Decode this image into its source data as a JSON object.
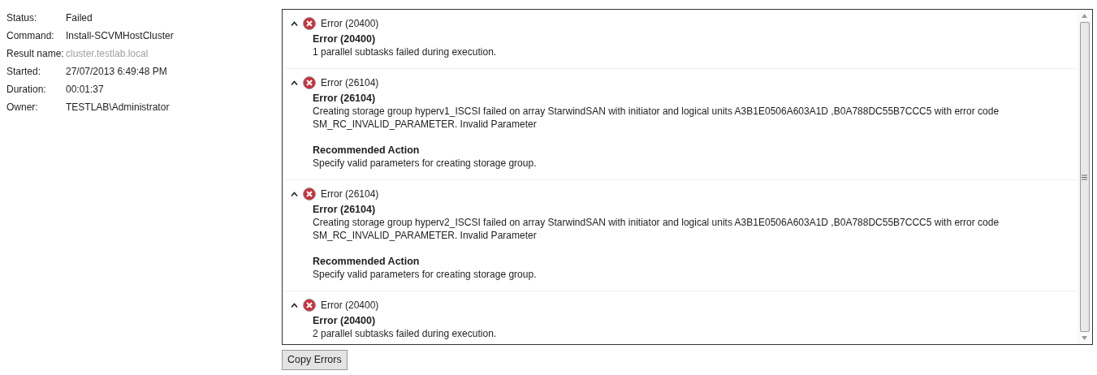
{
  "details": [
    {
      "label": "Status:",
      "value": "Failed",
      "disabled": false
    },
    {
      "label": "Command:",
      "value": "Install-SCVMHostCluster",
      "disabled": false
    },
    {
      "label": "Result name:",
      "value": "cluster.testlab.local",
      "disabled": true
    },
    {
      "label": "Started:",
      "value": "27/07/2013 6:49:48 PM",
      "disabled": false
    },
    {
      "label": "Duration:",
      "value": "00:01:37",
      "disabled": false
    },
    {
      "label": "Owner:",
      "value": "TESTLAB\\Administrator",
      "disabled": false
    }
  ],
  "errors": [
    {
      "title": "Error (20400)",
      "expanded": true,
      "sections": [
        {
          "heading": "Error (20400)",
          "lines": [
            "1 parallel subtasks failed during execution."
          ]
        }
      ]
    },
    {
      "title": "Error (26104)",
      "expanded": true,
      "sections": [
        {
          "heading": "Error (26104)",
          "lines": [
            "Creating storage group hyperv1_ISCSI failed on array StarwindSAN with initiator  and logical units A3B1E0506A603A1D ,B0A788DC55B7CCC5 with error code",
            "SM_RC_INVALID_PARAMETER. Invalid Parameter"
          ]
        },
        {
          "heading": "Recommended Action",
          "lines": [
            "Specify valid parameters for creating storage group."
          ]
        }
      ]
    },
    {
      "title": "Error (26104)",
      "expanded": true,
      "sections": [
        {
          "heading": "Error (26104)",
          "lines": [
            "Creating storage group hyperv2_ISCSI failed on array StarwindSAN with initiator  and logical units A3B1E0506A603A1D ,B0A788DC55B7CCC5 with error code",
            "SM_RC_INVALID_PARAMETER. Invalid Parameter"
          ]
        },
        {
          "heading": "Recommended Action",
          "lines": [
            "Specify valid parameters for creating storage group."
          ]
        }
      ]
    },
    {
      "title": "Error (20400)",
      "expanded": true,
      "sections": [
        {
          "heading": "Error (20400)",
          "lines": [
            "2 parallel subtasks failed during execution."
          ]
        }
      ]
    }
  ],
  "copy_button": "Copy Errors"
}
